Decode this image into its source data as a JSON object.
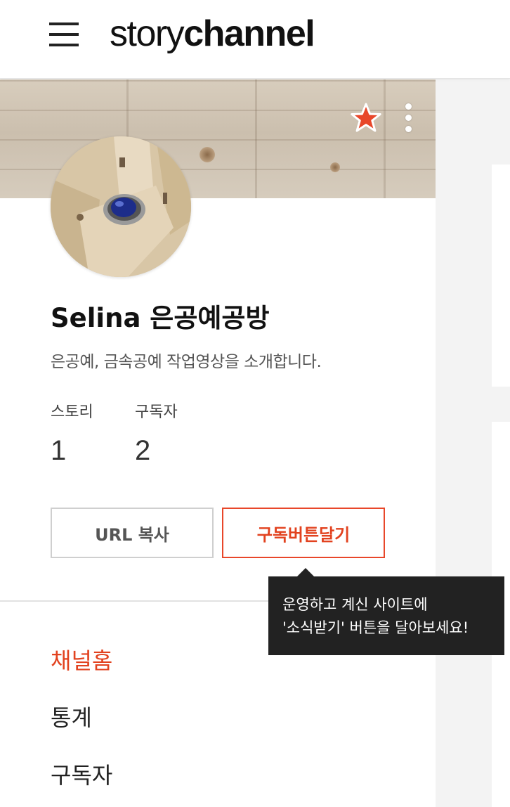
{
  "app": {
    "logo_story": "story",
    "logo_channel": "channel"
  },
  "profile": {
    "name": "Selina 은공예공방",
    "description": "은공예, 금속공예 작업영상을 소개합니다.",
    "stats": [
      {
        "label": "스토리",
        "value": "1"
      },
      {
        "label": "구독자",
        "value": "2"
      }
    ]
  },
  "buttons": {
    "url_copy": "URL 복사",
    "subscribe_button": "구독버튼달기"
  },
  "tooltip": {
    "line1": "운영하고 계신 사이트에",
    "line2": "'소식받기' 버튼을 달아보세요!"
  },
  "nav": {
    "items": [
      {
        "label": "채널홈",
        "active": true
      },
      {
        "label": "통계",
        "active": false
      },
      {
        "label": "구독자",
        "active": false
      }
    ]
  },
  "colors": {
    "accent": "#e2421f",
    "star": "#e8472a",
    "tooltip_bg": "#222222"
  },
  "icons": {
    "menu": "hamburger-menu-icon",
    "favorite": "star-icon",
    "more": "more-vertical-icon"
  }
}
